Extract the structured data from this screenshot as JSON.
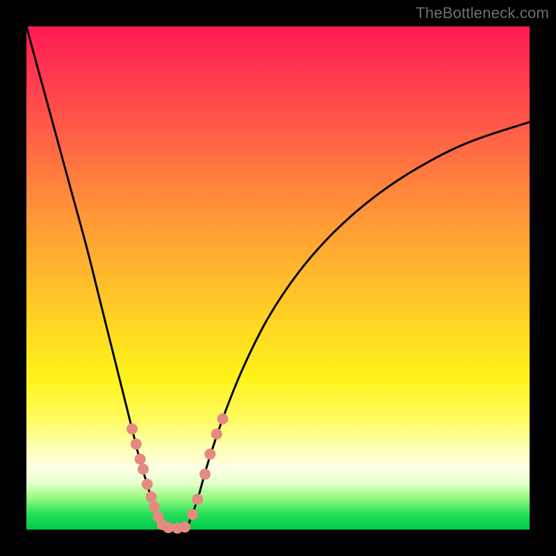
{
  "watermark": "TheBottleneck.com",
  "chart_data": {
    "type": "line",
    "title": "",
    "xlabel": "",
    "ylabel": "",
    "xlim": [
      0,
      100
    ],
    "ylim": [
      0,
      100
    ],
    "background_gradient": {
      "direction": "vertical",
      "stops": [
        {
          "pos": 0,
          "color": "#ff1a54"
        },
        {
          "pos": 20,
          "color": "#ff5b48"
        },
        {
          "pos": 48,
          "color": "#ffb52e"
        },
        {
          "pos": 70,
          "color": "#fff31a"
        },
        {
          "pos": 88,
          "color": "#feffe6"
        },
        {
          "pos": 100,
          "color": "#00c84a"
        }
      ]
    },
    "series": [
      {
        "name": "left-branch",
        "x": [
          0,
          3,
          6,
          9,
          12,
          15,
          17,
          19,
          21,
          22.5,
          24,
          25.5,
          27
        ],
        "y": [
          100,
          89,
          78,
          67,
          56,
          44,
          36,
          28,
          20,
          14,
          9,
          4,
          0.5
        ]
      },
      {
        "name": "floor",
        "x": [
          27,
          28,
          29,
          30,
          31,
          32
        ],
        "y": [
          0.5,
          0.3,
          0.3,
          0.3,
          0.3,
          0.5
        ]
      },
      {
        "name": "right-branch",
        "x": [
          32,
          34,
          36,
          39,
          43,
          48,
          54,
          61,
          69,
          78,
          88,
          100
        ],
        "y": [
          0.5,
          6,
          13,
          22,
          32,
          42,
          51,
          59,
          66,
          72,
          77,
          81
        ]
      }
    ],
    "markers": {
      "name": "highlighted-points",
      "color": "#e58a81",
      "radius": 8,
      "points": [
        {
          "x": 21.0,
          "y": 20
        },
        {
          "x": 21.8,
          "y": 17
        },
        {
          "x": 22.6,
          "y": 14
        },
        {
          "x": 23.2,
          "y": 12
        },
        {
          "x": 24.0,
          "y": 9
        },
        {
          "x": 24.8,
          "y": 6.5
        },
        {
          "x": 25.4,
          "y": 4.5
        },
        {
          "x": 26.2,
          "y": 2.5
        },
        {
          "x": 27.0,
          "y": 1.0
        },
        {
          "x": 28.2,
          "y": 0.4
        },
        {
          "x": 30.0,
          "y": 0.3
        },
        {
          "x": 31.5,
          "y": 0.5
        },
        {
          "x": 33.0,
          "y": 3.0
        },
        {
          "x": 34.0,
          "y": 6.0
        },
        {
          "x": 35.5,
          "y": 11.0
        },
        {
          "x": 36.5,
          "y": 15.0
        },
        {
          "x": 37.8,
          "y": 19.0
        },
        {
          "x": 39.0,
          "y": 22.0
        }
      ]
    }
  }
}
